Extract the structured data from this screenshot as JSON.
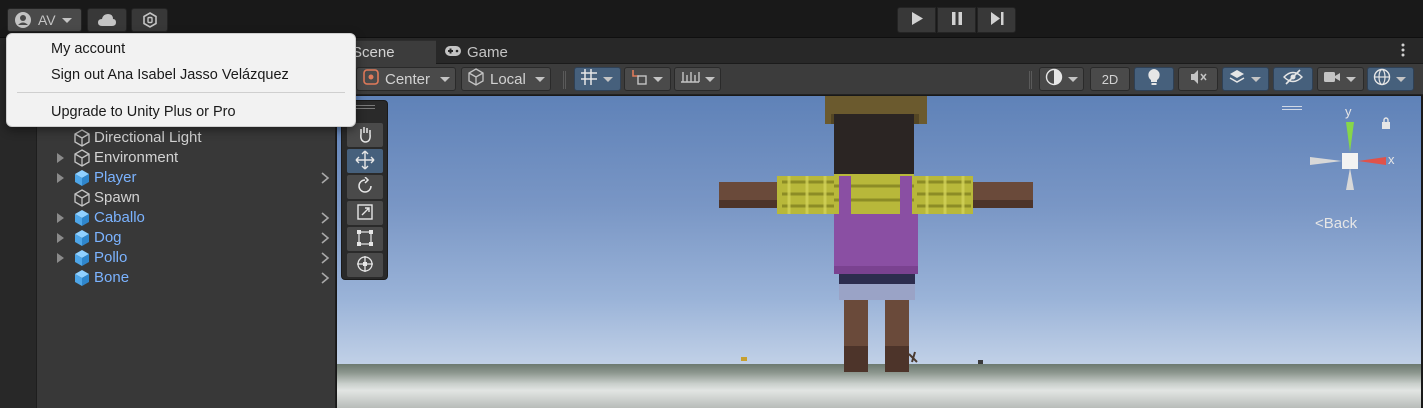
{
  "topbar": {
    "account_initials": "AV",
    "icons": [
      "user-icon",
      "cloud-icon",
      "collab-icon"
    ],
    "playmode": [
      "play-icon",
      "pause-icon",
      "step-icon"
    ]
  },
  "account_menu": {
    "items": [
      "My account",
      "Sign out Ana Isabel Jasso Velázquez",
      "Upgrade to Unity Plus or Pro"
    ]
  },
  "hierarchy": {
    "items": [
      {
        "label": "Directional Light",
        "style": "white",
        "expandable": false,
        "has_children_chevron": false,
        "prefab": false
      },
      {
        "label": "Environment",
        "style": "white",
        "expandable": true,
        "has_children_chevron": false,
        "prefab": false
      },
      {
        "label": "Player",
        "style": "blue",
        "expandable": true,
        "has_children_chevron": true,
        "prefab": true
      },
      {
        "label": "Spawn",
        "style": "white",
        "expandable": false,
        "has_children_chevron": false,
        "prefab": false
      },
      {
        "label": "Caballo",
        "style": "blue",
        "expandable": true,
        "has_children_chevron": true,
        "prefab": true
      },
      {
        "label": "Dog",
        "style": "blue",
        "expandable": true,
        "has_children_chevron": true,
        "prefab": true
      },
      {
        "label": "Pollo",
        "style": "blue",
        "expandable": true,
        "has_children_chevron": true,
        "prefab": true
      },
      {
        "label": "Bone",
        "style": "blue",
        "expandable": false,
        "has_children_chevron": true,
        "prefab": true
      }
    ]
  },
  "scene_tabs": {
    "scene": "Scene",
    "game": "Game"
  },
  "scene_toolbar": {
    "pivot": "Center",
    "space": "Local",
    "mode_2d": "2D"
  },
  "gizmo": {
    "axis_y": "y",
    "axis_x": "x",
    "back": "Back"
  },
  "colors": {
    "accent_blue": "#46607c",
    "prefab_text": "#7bb3ff",
    "menu_bg": "#f2f2f2",
    "sky_top": "#5f82b8",
    "overalls": "#8a4fa3",
    "shirt": "#b8b83a"
  }
}
